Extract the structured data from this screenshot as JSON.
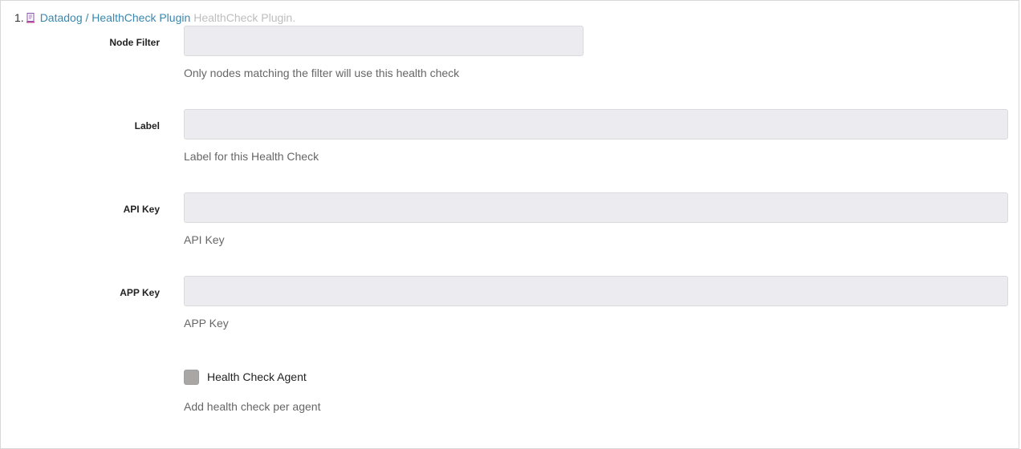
{
  "header": {
    "index": "1.",
    "icon": "plugin-icon",
    "plugin_link": "Datadog / HealthCheck Plugin",
    "plugin_description": "HealthCheck Plugin."
  },
  "fields": {
    "node_filter": {
      "label": "Node Filter",
      "value": "",
      "help": "Only nodes matching the filter will use this health check"
    },
    "label": {
      "label": "Label",
      "value": "",
      "help": "Label for this Health Check"
    },
    "api_key": {
      "label": "API Key",
      "value": "",
      "help": "API Key"
    },
    "app_key": {
      "label": "APP Key",
      "value": "",
      "help": "APP Key"
    }
  },
  "health_check_agent": {
    "label": "Health Check Agent",
    "checked": false,
    "help": "Add health check per agent"
  },
  "colors": {
    "link": "#3a87ad",
    "input_bg": "#ebebf0",
    "checkbox_bg": "#a9a7a5"
  }
}
